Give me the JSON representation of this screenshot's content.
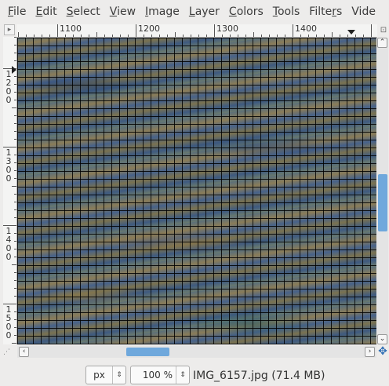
{
  "menubar": {
    "items": [
      {
        "label": "File",
        "mnemonic": "F",
        "rest": "ile"
      },
      {
        "label": "Edit",
        "mnemonic": "E",
        "rest": "dit"
      },
      {
        "label": "Select",
        "mnemonic": "S",
        "rest": "elect"
      },
      {
        "label": "View",
        "mnemonic": "V",
        "rest": "iew"
      },
      {
        "label": "Image",
        "mnemonic": "I",
        "rest": "mage"
      },
      {
        "label": "Layer",
        "mnemonic": "L",
        "rest": "ayer"
      },
      {
        "label": "Colors",
        "mnemonic": "C",
        "rest": "olors"
      },
      {
        "label": "Tools",
        "mnemonic": "T",
        "rest": "ools"
      },
      {
        "label": "Filters",
        "mnemonic": "r",
        "prefix": "Filte",
        "rest": "s"
      },
      {
        "label": "Vide",
        "mnemonic": "",
        "rest": "Vide"
      }
    ]
  },
  "rulers": {
    "horizontal_labels": [
      "1100",
      "1200",
      "1300",
      "1400"
    ],
    "vertical_labels": [
      "1200",
      "1300",
      "1400",
      "1500"
    ]
  },
  "icons": {
    "corner": "ruler-corner-icon",
    "zoom_nav": "zoom-navigation-icon",
    "quick_mask": "quick-mask-icon",
    "navigate": "navigate-icon"
  },
  "scrollbars": {
    "vertical_position": 0.55,
    "vertical_thumb_size": 0.2,
    "horizontal_position": 0.33,
    "horizontal_thumb_size": 0.13
  },
  "statusbar": {
    "unit": "px",
    "zoom": "100 %",
    "status": "IMG_6157.jpg (71.4 MB)"
  },
  "colors": {
    "accent": "#6fa8dc",
    "background": "#edeceb"
  }
}
